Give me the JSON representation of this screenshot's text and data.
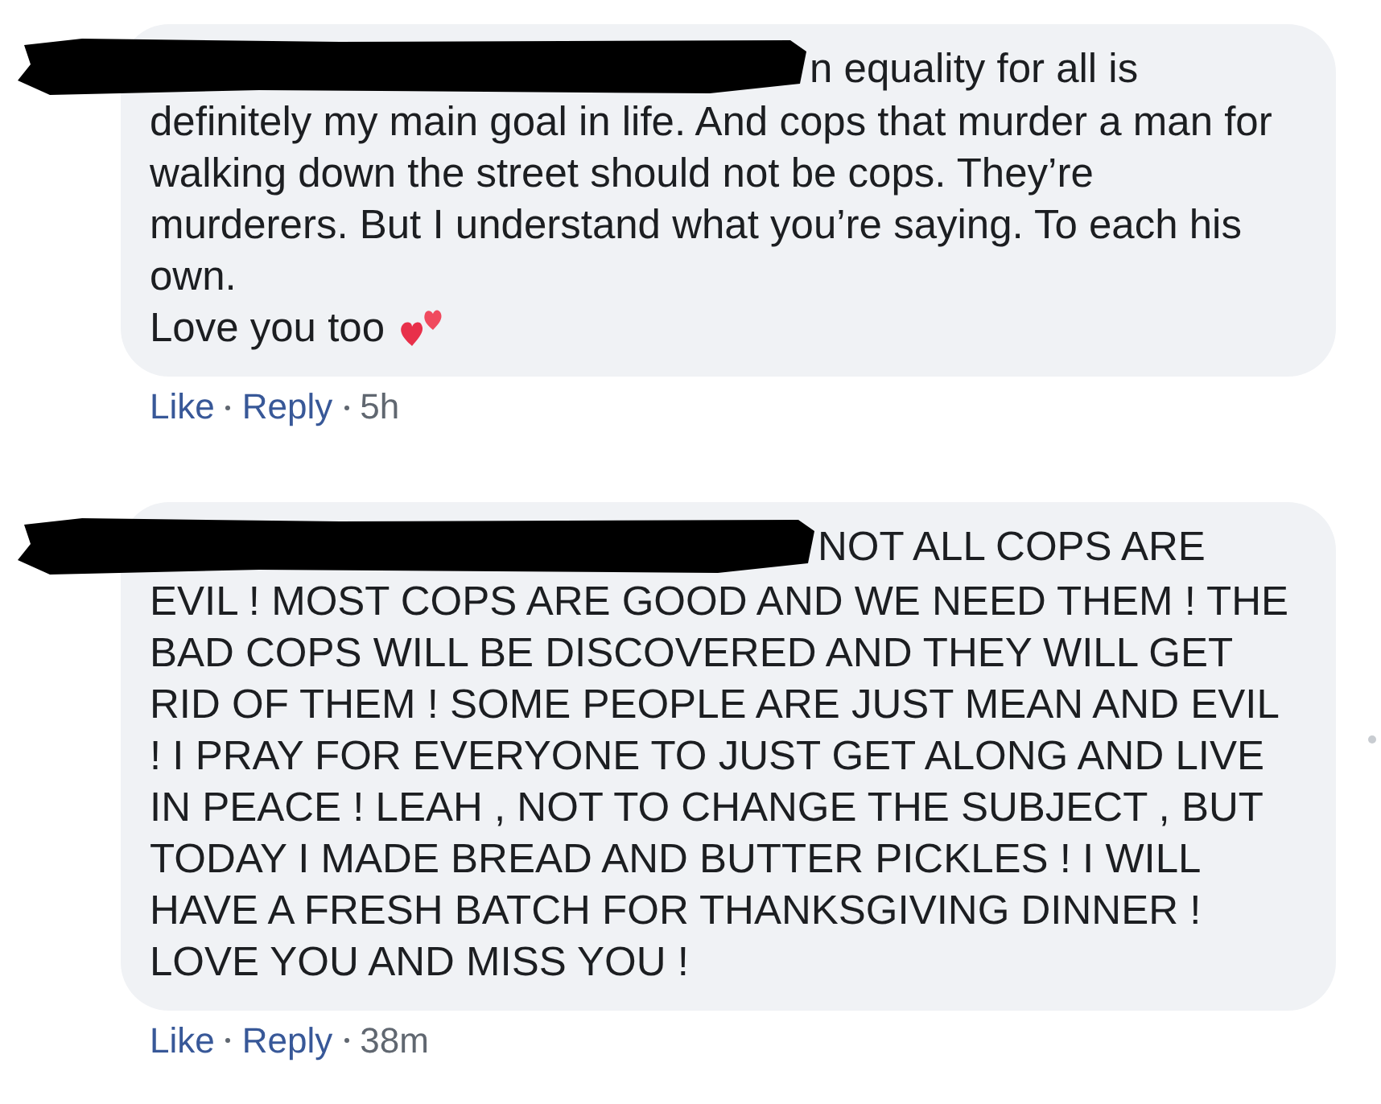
{
  "comments": [
    {
      "text_start": "n equality for all is definitely my main goal in life. And cops that murder a man for walking down the street should not be cops. They’re murderers. But I understand what you’re saying. To each his own.",
      "text_end": "Love you too",
      "reaction_emoji": true,
      "actions": [
        {
          "label": "Like"
        },
        {
          "label": "Reply"
        }
      ],
      "time": "5h"
    },
    {
      "text_start": "NOT ALL COPS ARE EVIL ! MOST COPS ARE GOOD AND WE NEED THEM ! THE BAD COPS WILL BE DISCOVERED AND THEY WILL GET RID OF THEM ! SOME PEOPLE ARE JUST MEAN AND EVIL ! I PRAY FOR EVERYONE TO JUST GET ALONG AND LIVE IN PEACE ! LEAH , NOT TO CHANGE THE SUBJECT , BUT TODAY I MADE BREAD AND BUTTER PICKLES ! I WILL HAVE A FRESH BATCH FOR THANKSGIVING DINNER ! LOVE YOU AND MISS YOU !",
      "actions": [
        {
          "label": "Like"
        },
        {
          "label": "Reply"
        }
      ],
      "time": "38m"
    }
  ]
}
